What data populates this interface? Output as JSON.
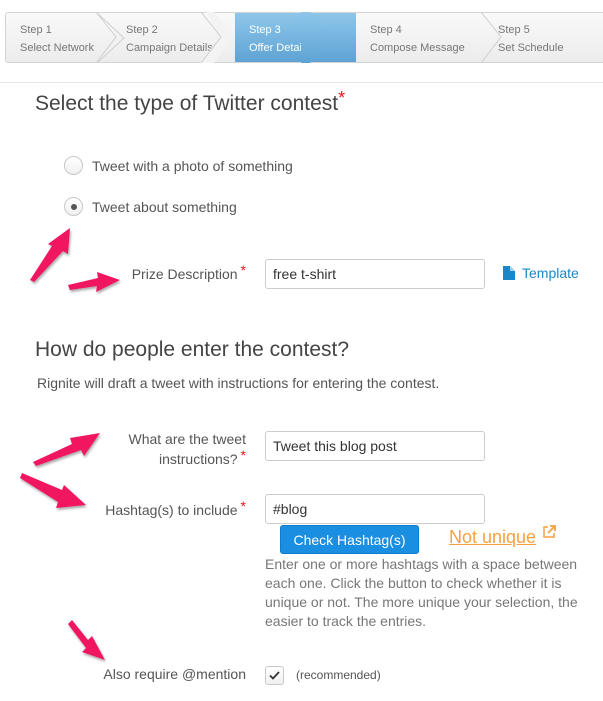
{
  "wizard": {
    "steps": [
      {
        "step": "Step 1",
        "label": "Select Network",
        "active": false
      },
      {
        "step": "Step 2",
        "label": "Campaign Details",
        "active": false
      },
      {
        "step": "Step 3",
        "label": "Offer Details",
        "active": true
      },
      {
        "step": "Step 4",
        "label": "Compose Message",
        "active": false
      },
      {
        "step": "Step 5",
        "label": "Set Schedule",
        "active": false
      }
    ]
  },
  "contest_type": {
    "heading": "Select the type of Twitter contest",
    "required_mark": "*",
    "options": [
      {
        "label": "Tweet with a photo of something",
        "selected": false
      },
      {
        "label": "Tweet about something",
        "selected": true
      }
    ]
  },
  "prize": {
    "label": "Prize Description",
    "required_mark": "*",
    "value": "free t-shirt",
    "template_link": "Template"
  },
  "entry": {
    "heading": "How do people enter the contest?",
    "description": "Rignite will draft a tweet with instructions for entering the contest.",
    "instructions_label_line1": "What are the tweet",
    "instructions_label_line2": "instructions?",
    "instructions_value": "Tweet this blog post",
    "hashtag_label": "Hashtag(s) to include",
    "hashtag_value": "#blog",
    "check_button": "Check Hashtag(s)",
    "uniqueness_status": "Not unique",
    "hashtag_help": "Enter one or more hashtags with a space between each one. Click the button to check whether it is unique or not. The more unique your selection, the easier to track the entries.",
    "mention_label": "Also require @mention",
    "mention_checked": true,
    "mention_note": "(recommended)",
    "required_mark": "*"
  },
  "colors": {
    "accent_blue": "#1a8ee1",
    "warning_orange": "#f5a142",
    "required_red": "#e3151a",
    "annotation_arrow": "#f0195f"
  }
}
